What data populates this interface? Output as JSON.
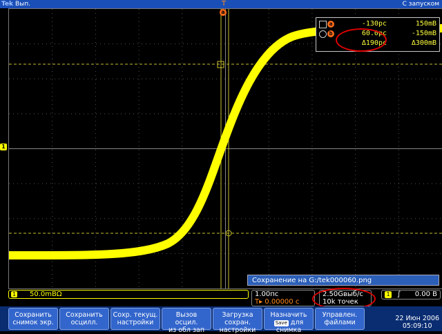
{
  "top_bar": {
    "logo": "Tek",
    "acq_state": "Вып.",
    "trigger_mode": "С запуском"
  },
  "markers": {
    "channel": "1",
    "trigger_pos": "T",
    "cursor_a": "a"
  },
  "cursor_readout": {
    "rows": [
      {
        "badge": "a",
        "time": "-130pc",
        "value": "150mB"
      },
      {
        "badge": "b",
        "time": "60.0pc",
        "value": "-150mB"
      },
      {
        "badge": "",
        "time": "Δ190pc",
        "value": "Δ300mB"
      }
    ]
  },
  "save_message": "Сохранение на G:/tek000060.png",
  "channel_scale": {
    "num": "1",
    "value": "50.0mBΩ"
  },
  "timebase": {
    "time_div": "1.00пс",
    "delay": "T▸ 0.00000 с"
  },
  "sample": {
    "rate": "2.50Gвыб/с",
    "points": "10k точек"
  },
  "trigger": {
    "num": "1",
    "slope": "∫",
    "level": "0.00 B"
  },
  "menu": {
    "buttons": [
      {
        "l1": "Сохранить",
        "l2": "снимок экр.",
        "l3": ""
      },
      {
        "l1": "Сохранить",
        "l2": "осцилл.",
        "l3": ""
      },
      {
        "l1": "Сохр. текущ.",
        "l2": "настройки",
        "l3": ""
      },
      {
        "l1": "Вызов",
        "l2": "осцил.",
        "l3": "из обл зап"
      },
      {
        "l1": "Загрузка",
        "l2": "сохран.",
        "l3": "настройки"
      },
      {
        "l1": "Назначить",
        "chip": "Save",
        "l2": "для",
        "l3": "снимка"
      },
      {
        "l1": "Управлен.",
        "l2": "файлами",
        "l3": ""
      }
    ]
  },
  "clock": {
    "date": "22 Июн 2006",
    "time": "05:09:10"
  },
  "colors": {
    "trace": "#ffff00",
    "cursor": "#c8c030",
    "accent": "#ff6b1a",
    "menu_bg": "#3366cc"
  }
}
